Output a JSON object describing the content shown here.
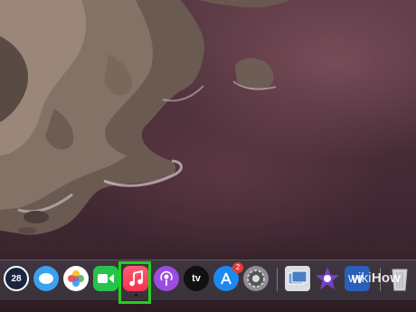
{
  "desktop": {
    "wallpaper": "coastal-cliffs"
  },
  "dock": {
    "items": [
      {
        "name": "Calendar",
        "icon": "calendar-icon",
        "label": "28"
      },
      {
        "name": "Messages",
        "icon": "messages-icon"
      },
      {
        "name": "Photos",
        "icon": "photos-icon"
      },
      {
        "name": "FaceTime",
        "icon": "facetime-icon"
      },
      {
        "name": "Music",
        "icon": "music-icon",
        "running": true,
        "highlighted": true
      },
      {
        "name": "Podcasts",
        "icon": "podcasts-icon"
      },
      {
        "name": "TV",
        "icon": "apple-tv-icon",
        "label": "tv"
      },
      {
        "name": "App Store",
        "icon": "app-store-icon",
        "badge": "2"
      },
      {
        "name": "System Preferences",
        "icon": "gear-icon"
      },
      {
        "name": "Preview",
        "icon": "preview-icon"
      },
      {
        "name": "iMovie",
        "icon": "imovie-star-icon"
      },
      {
        "name": "Microsoft Word",
        "icon": "word-icon",
        "label": "W"
      },
      {
        "name": "Trash",
        "icon": "trash-icon"
      }
    ],
    "highlight_color": "#22d01c"
  },
  "watermark": {
    "part1": "wiki",
    "part2": "How"
  }
}
